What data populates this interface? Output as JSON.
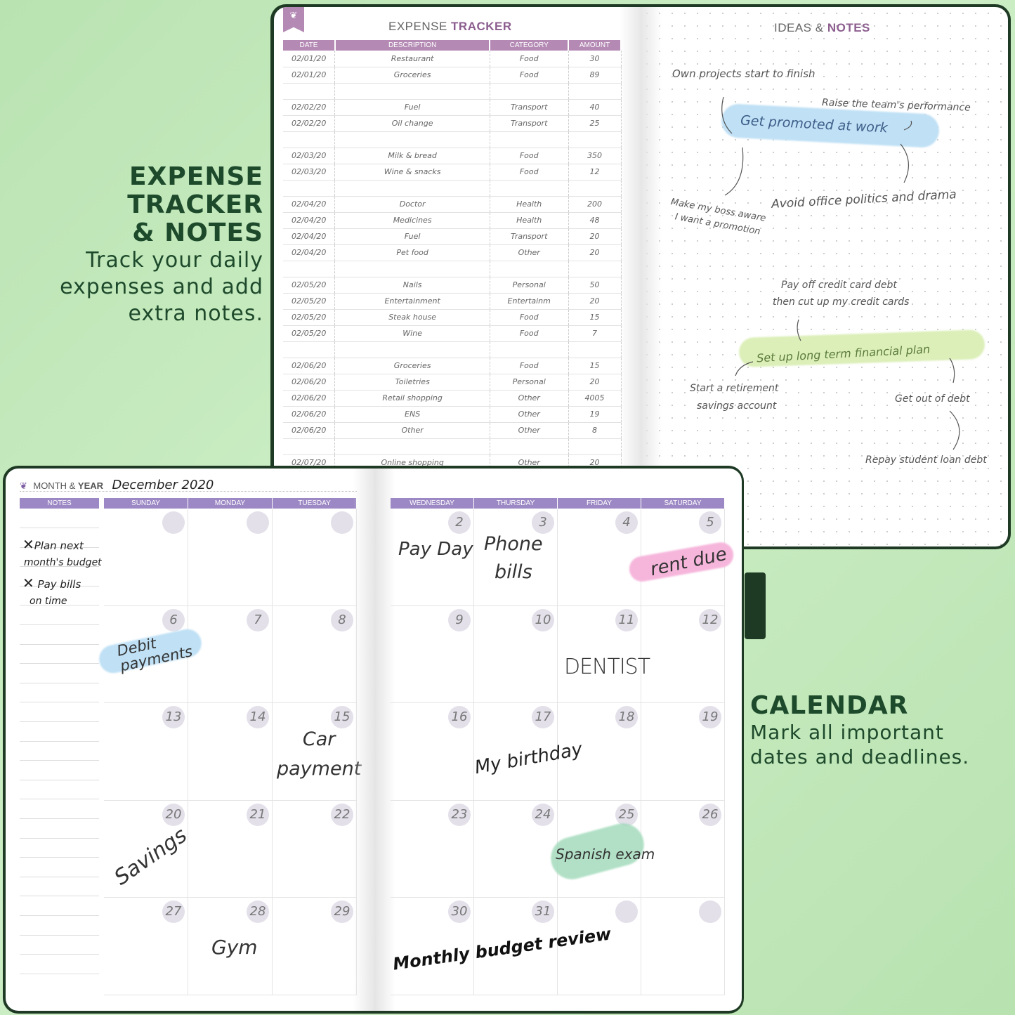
{
  "promo_top": {
    "title_lines": [
      "EXPENSE",
      "TRACKER",
      "& NOTES"
    ],
    "text_lines": [
      "Track your daily",
      "expenses and add",
      "extra notes."
    ]
  },
  "promo_bottom": {
    "title": "CALENDAR",
    "text_lines": [
      "Mark all important",
      "dates and deadlines."
    ]
  },
  "expense": {
    "title_a": "EXPENSE ",
    "title_b": "TRACKER",
    "columns": [
      "DATE",
      "DESCRIPTION",
      "CATEGORY",
      "AMOUNT"
    ],
    "rows": [
      [
        "02/01/20",
        "Restaurant",
        "Food",
        "30"
      ],
      [
        "02/01/20",
        "Groceries",
        "Food",
        "89"
      ],
      null,
      [
        "02/02/20",
        "Fuel",
        "Transport",
        "40"
      ],
      [
        "02/02/20",
        "Oil change",
        "Transport",
        "25"
      ],
      null,
      [
        "02/03/20",
        "Milk & bread",
        "Food",
        "350"
      ],
      [
        "02/03/20",
        "Wine & snacks",
        "Food",
        "12"
      ],
      null,
      [
        "02/04/20",
        "Doctor",
        "Health",
        "200"
      ],
      [
        "02/04/20",
        "Medicines",
        "Health",
        "48"
      ],
      [
        "02/04/20",
        "Fuel",
        "Transport",
        "20"
      ],
      [
        "02/04/20",
        "Pet food",
        "Other",
        "20"
      ],
      null,
      [
        "02/05/20",
        "Nails",
        "Personal",
        "50"
      ],
      [
        "02/05/20",
        "Entertainment",
        "Entertainm",
        "20"
      ],
      [
        "02/05/20",
        "Steak house",
        "Food",
        "15"
      ],
      [
        "02/05/20",
        "Wine",
        "Food",
        "7"
      ],
      null,
      [
        "02/06/20",
        "Groceries",
        "Food",
        "15"
      ],
      [
        "02/06/20",
        "Toiletries",
        "Personal",
        "20"
      ],
      [
        "02/06/20",
        "Retail shopping",
        "Other",
        "4005"
      ],
      [
        "02/06/20",
        "ENS",
        "Other",
        "19"
      ],
      [
        "02/06/20",
        "Other",
        "Other",
        "8"
      ],
      null,
      [
        "02/07/20",
        "Online shopping",
        "Other",
        "20"
      ]
    ]
  },
  "ideas": {
    "title_a": "IDEAS & ",
    "title_b": "NOTES",
    "notes": [
      "Own projects start to finish",
      "Raise the team's performance",
      "Get promoted at work",
      "Avoid office politics and drama",
      "Make my boss aware",
      "I want a promotion",
      "Pay off credit card debt",
      "then cut up my credit cards",
      "Set up long term financial plan",
      "Start a retirement",
      "savings account",
      "Get out of debt",
      "Repay student loan debt"
    ]
  },
  "calendar": {
    "label_a": "MONTH & ",
    "label_b": "YEAR",
    "month": "December 2020",
    "notes_header": "NOTES",
    "days_left": [
      "SUNDAY",
      "MONDAY",
      "TUESDAY"
    ],
    "days_right": [
      "WEDNESDAY",
      "THURSDAY",
      "FRIDAY",
      "SATURDAY"
    ],
    "left_weeks": [
      [
        "",
        "",
        ""
      ],
      [
        "6",
        "7",
        "8"
      ],
      [
        "13",
        "14",
        "15"
      ],
      [
        "20",
        "21",
        "22"
      ],
      [
        "27",
        "28",
        "29"
      ]
    ],
    "right_weeks": [
      [
        "2",
        "3",
        "4",
        "5"
      ],
      [
        "9",
        "10",
        "11",
        "12"
      ],
      [
        "16",
        "17",
        "18",
        "19"
      ],
      [
        "23",
        "24",
        "25",
        "26"
      ],
      [
        "30",
        "31",
        "",
        ""
      ]
    ],
    "notes": [
      "Plan next",
      "month's budget",
      "Pay bills",
      "on time"
    ],
    "events": {
      "pay_day": "Pay Day",
      "phone": "Phone",
      "bills": "bills",
      "rent": "rent due",
      "debit1": "Debit",
      "debit2": "payments",
      "dentist": "DENTIST",
      "car": "Car",
      "payment": "payment",
      "birthday": "My birthday",
      "savings": "Savings",
      "spanish": "Spanish exam",
      "gym": "Gym",
      "review": "Monthly budget review"
    }
  },
  "colors": {
    "background": "#c4e9bc",
    "cover": "#1f3a24",
    "expense_header": "#b48ab4",
    "calendar_header": "#9c88c4",
    "promo_text": "#1e4a2c",
    "hl_blue": "#bfe0f5",
    "hl_green": "#dcefb8",
    "hl_pink": "#f6b6dc",
    "hl_mint": "#9ed9b8"
  }
}
